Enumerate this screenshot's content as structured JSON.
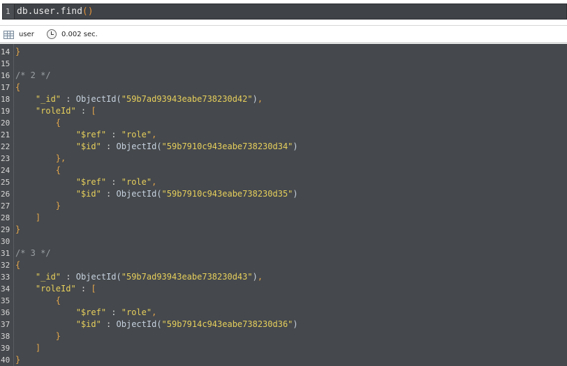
{
  "query_editor": {
    "line_number": "1",
    "query_text": "db.user.find",
    "query_parens": "()"
  },
  "result_toolbar": {
    "collection": "user",
    "elapsed": "0.002 sec.",
    "table_icon": "table-icon",
    "clock_icon": "clock-icon"
  },
  "result_lines": [
    {
      "n": "14",
      "indent": 0,
      "tokens": [
        {
          "t": "}",
          "c": "t-punct"
        }
      ]
    },
    {
      "n": "15",
      "indent": 0,
      "tokens": []
    },
    {
      "n": "16",
      "indent": 0,
      "tokens": [
        {
          "t": "/* 2 */",
          "c": "t-comment"
        }
      ]
    },
    {
      "n": "17",
      "indent": 0,
      "tokens": [
        {
          "t": "{",
          "c": "t-punct"
        }
      ]
    },
    {
      "n": "18",
      "indent": 1,
      "tokens": [
        {
          "t": "\"_id\"",
          "c": "t-key"
        },
        {
          "t": " : ",
          "c": "t-plain"
        },
        {
          "t": "ObjectId(",
          "c": "t-func"
        },
        {
          "t": "\"59b7ad93943eabe738230d42\"",
          "c": "t-str"
        },
        {
          "t": ")",
          "c": "t-func"
        },
        {
          "t": ",",
          "c": "t-punct"
        }
      ]
    },
    {
      "n": "19",
      "indent": 1,
      "tokens": [
        {
          "t": "\"roleId\"",
          "c": "t-key"
        },
        {
          "t": " : ",
          "c": "t-plain"
        },
        {
          "t": "[",
          "c": "t-punct"
        }
      ]
    },
    {
      "n": "20",
      "indent": 2,
      "tokens": [
        {
          "t": "{",
          "c": "t-punct"
        }
      ]
    },
    {
      "n": "21",
      "indent": 3,
      "tokens": [
        {
          "t": "\"$ref\"",
          "c": "t-key"
        },
        {
          "t": " : ",
          "c": "t-plain"
        },
        {
          "t": "\"role\"",
          "c": "t-str"
        },
        {
          "t": ",",
          "c": "t-punct"
        }
      ]
    },
    {
      "n": "22",
      "indent": 3,
      "tokens": [
        {
          "t": "\"$id\"",
          "c": "t-key"
        },
        {
          "t": " : ",
          "c": "t-plain"
        },
        {
          "t": "ObjectId(",
          "c": "t-func"
        },
        {
          "t": "\"59b7910c943eabe738230d34\"",
          "c": "t-str"
        },
        {
          "t": ")",
          "c": "t-func"
        }
      ]
    },
    {
      "n": "23",
      "indent": 2,
      "tokens": [
        {
          "t": "},",
          "c": "t-punct"
        }
      ]
    },
    {
      "n": "24",
      "indent": 2,
      "tokens": [
        {
          "t": "{",
          "c": "t-punct"
        }
      ]
    },
    {
      "n": "25",
      "indent": 3,
      "tokens": [
        {
          "t": "\"$ref\"",
          "c": "t-key"
        },
        {
          "t": " : ",
          "c": "t-plain"
        },
        {
          "t": "\"role\"",
          "c": "t-str"
        },
        {
          "t": ",",
          "c": "t-punct"
        }
      ]
    },
    {
      "n": "26",
      "indent": 3,
      "tokens": [
        {
          "t": "\"$id\"",
          "c": "t-key"
        },
        {
          "t": " : ",
          "c": "t-plain"
        },
        {
          "t": "ObjectId(",
          "c": "t-func"
        },
        {
          "t": "\"59b7910c943eabe738230d35\"",
          "c": "t-str"
        },
        {
          "t": ")",
          "c": "t-func"
        }
      ]
    },
    {
      "n": "27",
      "indent": 2,
      "tokens": [
        {
          "t": "}",
          "c": "t-punct"
        }
      ]
    },
    {
      "n": "28",
      "indent": 1,
      "tokens": [
        {
          "t": "]",
          "c": "t-punct"
        }
      ]
    },
    {
      "n": "29",
      "indent": 0,
      "tokens": [
        {
          "t": "}",
          "c": "t-punct"
        }
      ]
    },
    {
      "n": "30",
      "indent": 0,
      "tokens": []
    },
    {
      "n": "31",
      "indent": 0,
      "tokens": [
        {
          "t": "/* 3 */",
          "c": "t-comment"
        }
      ]
    },
    {
      "n": "32",
      "indent": 0,
      "tokens": [
        {
          "t": "{",
          "c": "t-punct"
        }
      ]
    },
    {
      "n": "33",
      "indent": 1,
      "tokens": [
        {
          "t": "\"_id\"",
          "c": "t-key"
        },
        {
          "t": " : ",
          "c": "t-plain"
        },
        {
          "t": "ObjectId(",
          "c": "t-func"
        },
        {
          "t": "\"59b7ad93943eabe738230d43\"",
          "c": "t-str"
        },
        {
          "t": ")",
          "c": "t-func"
        },
        {
          "t": ",",
          "c": "t-punct"
        }
      ]
    },
    {
      "n": "34",
      "indent": 1,
      "tokens": [
        {
          "t": "\"roleId\"",
          "c": "t-key"
        },
        {
          "t": " : ",
          "c": "t-plain"
        },
        {
          "t": "[",
          "c": "t-punct"
        }
      ]
    },
    {
      "n": "35",
      "indent": 2,
      "tokens": [
        {
          "t": "{",
          "c": "t-punct"
        }
      ]
    },
    {
      "n": "36",
      "indent": 3,
      "tokens": [
        {
          "t": "\"$ref\"",
          "c": "t-key"
        },
        {
          "t": " : ",
          "c": "t-plain"
        },
        {
          "t": "\"role\"",
          "c": "t-str"
        },
        {
          "t": ",",
          "c": "t-punct"
        }
      ]
    },
    {
      "n": "37",
      "indent": 3,
      "tokens": [
        {
          "t": "\"$id\"",
          "c": "t-key"
        },
        {
          "t": " : ",
          "c": "t-plain"
        },
        {
          "t": "ObjectId(",
          "c": "t-func"
        },
        {
          "t": "\"59b7914c943eabe738230d36\"",
          "c": "t-str"
        },
        {
          "t": ")",
          "c": "t-func"
        }
      ]
    },
    {
      "n": "38",
      "indent": 2,
      "tokens": [
        {
          "t": "}",
          "c": "t-punct"
        }
      ]
    },
    {
      "n": "39",
      "indent": 1,
      "tokens": [
        {
          "t": "]",
          "c": "t-punct"
        }
      ]
    },
    {
      "n": "40",
      "indent": 0,
      "tokens": [
        {
          "t": "}",
          "c": "t-punct"
        }
      ]
    }
  ]
}
